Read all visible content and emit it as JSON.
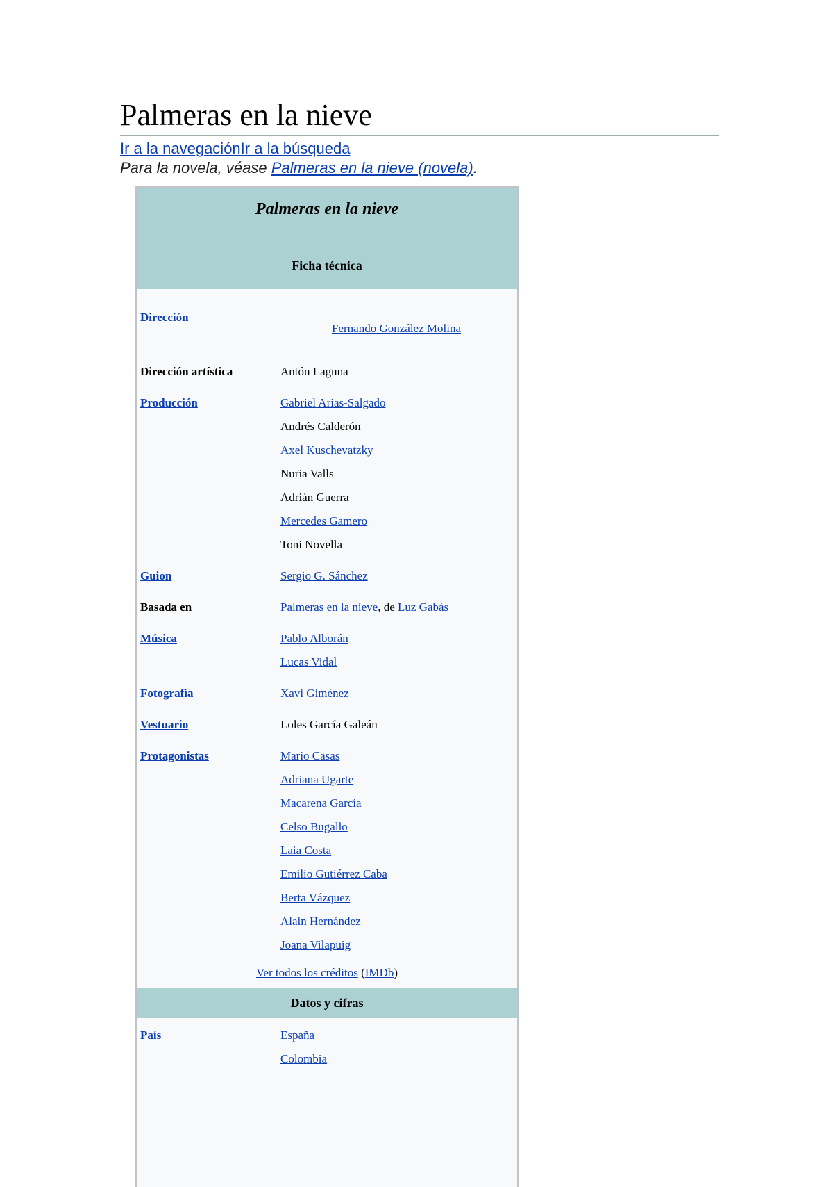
{
  "page": {
    "title": "Palmeras en la nieve",
    "jump_nav": "Ir a la navegación",
    "jump_search": "Ir a la búsqueda",
    "hatnote_prefix": "Para la novela, véase ",
    "hatnote_link": "Palmeras en la nieve (novela)",
    "hatnote_suffix": "."
  },
  "infobox": {
    "title": "Palmeras en la nieve",
    "section_ficha": "Ficha técnica",
    "direccion": {
      "label": "Dirección",
      "values": [
        "Fernando González Molina"
      ]
    },
    "direccion_artistica": {
      "label": "Dirección artística",
      "values": [
        "Antón Laguna"
      ]
    },
    "produccion": {
      "label": "Producción",
      "values": [
        "Gabriel Arias-Salgado",
        "Andrés Calderón",
        "Axel Kuschevatzky",
        "Nuria Valls",
        "Adrián Guerra",
        "Mercedes Gamero",
        "Toni Novella"
      ]
    },
    "guion": {
      "label": "Guion",
      "values": [
        "Sergio G. Sánchez"
      ]
    },
    "basada_en": {
      "label": "Basada en",
      "book": "Palmeras en la nieve",
      "sep": ", de ",
      "author": "Luz Gabás"
    },
    "musica": {
      "label": "Música",
      "values": [
        "Pablo Alborán",
        "Lucas Vidal"
      ]
    },
    "fotografia": {
      "label": "Fotografía",
      "values": [
        "Xavi Giménez"
      ]
    },
    "vestuario": {
      "label": "Vestuario",
      "values": [
        "Loles García Galeán"
      ]
    },
    "protagonistas": {
      "label": "Protagonistas",
      "values": [
        "Mario Casas",
        "Adriana Ugarte",
        "Macarena García",
        "Celso Bugallo",
        "Laia Costa",
        "Emilio Gutiérrez Caba",
        "Berta Vázquez",
        "Alain Hernández",
        "Joana Vilapuig"
      ]
    },
    "credits": {
      "link": "Ver todos los créditos",
      "open": " (",
      "imdb": "IMDb",
      "close": ")"
    },
    "section_datos": "Datos y cifras",
    "pais": {
      "label": "País",
      "values": [
        "España",
        "Colombia"
      ]
    }
  },
  "colors": {
    "header_bg": "#abd1d2",
    "link": "#0b3fb0",
    "infobox_bg": "#f8f9fa"
  }
}
